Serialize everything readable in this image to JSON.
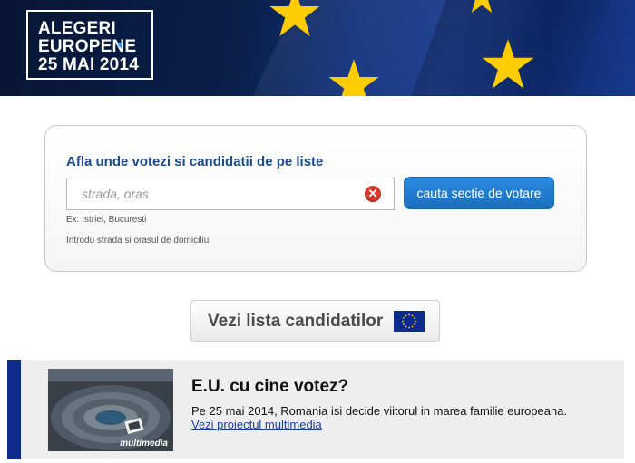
{
  "header": {
    "logo_lines": [
      "ALEGERI",
      "EUROPENE",
      "25 MAI 2014"
    ]
  },
  "search": {
    "title": "Afla unde votezi si candidatii de pe liste",
    "placeholder": "strada, oras",
    "value": "",
    "button_label": "cauta sectie de votare",
    "hint_example": "Ex: Istriei, Bucuresti",
    "hint_instruction": "Introdu strada si orasul de domiciliu"
  },
  "candidates": {
    "button_label": "Vezi lista candidatilor"
  },
  "feature": {
    "title": "E.U. cu cine votez?",
    "text": "Pe 25 mai 2014, Romania isi decide viitorul in marea familie europeana.",
    "link_label": "Vezi proiectul multimedia",
    "thumb_label": "multimedia"
  },
  "colors": {
    "eu_blue": "#0e2a8c",
    "eu_gold": "#ffcc00",
    "title_blue": "#1d4a8c",
    "button_blue": "#1a6fbf",
    "clear_red": "#d93a30"
  },
  "icons": {
    "clear": "clear-x-icon",
    "flag": "eu-flag-icon"
  }
}
